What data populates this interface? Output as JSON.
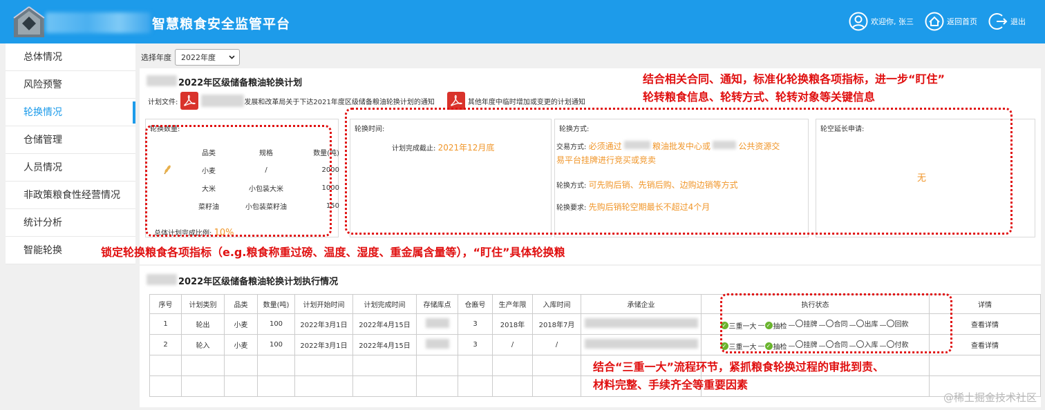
{
  "header": {
    "title": "智慧粮食安全监管平台",
    "welcome": "欢迎你, 张三",
    "home": "返回首页",
    "logout": "退出"
  },
  "sidebar": {
    "items": [
      "总体情况",
      "风险预警",
      "轮换情况",
      "仓储管理",
      "人员情况",
      "非政策粮食性经营情况",
      "统计分析",
      "智能轮换"
    ],
    "active_index": 2
  },
  "filter": {
    "label": "选择年度",
    "value": "2022年度"
  },
  "plan": {
    "title": "2022年区级储备粮油轮换计划",
    "files_label": "计划文件:",
    "file1": "发展和改革局关于下达2021年度区级储备粮油轮换计划的通知",
    "file2": "其他年度中临时增加或变更的计划通知",
    "qty_label": "轮换数量:",
    "qty_headers": [
      "品类",
      "规格",
      "数量(吨)"
    ],
    "qty_rows": [
      {
        "name": "小麦",
        "spec": "/",
        "qty": "2000"
      },
      {
        "name": "大米",
        "spec": "小包装大米",
        "qty": "1000"
      },
      {
        "name": "菜籽油",
        "spec": "小包装菜籽油",
        "qty": "150"
      }
    ],
    "completion_label": "总体计划完成比例:",
    "completion_value": "10%",
    "time_label": "轮换时间:",
    "deadline_label": "计划完成截止:",
    "deadline_value": "2021年12月底",
    "method_label": "轮换方式:",
    "trade_label": "交易方式:",
    "trade_value_a": "必须通过",
    "trade_value_b": "粮油批发中心或",
    "trade_value_c": "公共资源交",
    "trade_value_d": "易平台挂牌进行竞买或竞卖",
    "rot_label": "轮换方式:",
    "rot_value": "可先购后销、先销后购、边购边销等方式",
    "req_label": "轮换要求:",
    "req_value": "先购后销轮空期最长不超过4个月",
    "ext_label": "轮空延长申请:",
    "ext_value": "无"
  },
  "exec": {
    "title": "2022年区级储备粮油轮换计划执行情况",
    "headers": [
      "序号",
      "计划类别",
      "品类",
      "数量(吨)",
      "计划开始时间",
      "计划完成时间",
      "存储库点",
      "仓廒号",
      "生产年限",
      "入库时间",
      "承储企业",
      "执行状态",
      "详情"
    ],
    "rows": [
      {
        "no": "1",
        "type": "轮出",
        "cat": "小麦",
        "qty": "100",
        "start": "2022年3月1日",
        "end": "2022年4月15日",
        "bin": "3",
        "year": "2018年",
        "in": "2018年7月",
        "steps": [
          "三重一大",
          "抽检",
          "挂牌",
          "合同",
          "出库",
          "回款"
        ],
        "done": 2,
        "detail": "查看详情"
      },
      {
        "no": "2",
        "type": "轮入",
        "cat": "小麦",
        "qty": "100",
        "start": "2022年3月1日",
        "end": "2022年4月15日",
        "bin": "3",
        "year": "/",
        "in": "/",
        "steps": [
          "三重一大",
          "抽检",
          "挂牌",
          "合同",
          "入库",
          "付款"
        ],
        "done": 2,
        "detail": "查看详情"
      }
    ]
  },
  "annotations": {
    "top_line1": "结合相关合同、通知，标准化轮换粮各项指标，进一步“盯住”",
    "top_line2": "轮转粮食信息、轮转方式、轮转对象等关键信息",
    "middle": "锁定轮换粮食各项指标（e.g.粮食称重过磅、温度、湿度、重金属含量等），“盯住”具体轮换粮",
    "bottom_line1": "结合“三重一大”流程环节，紧抓粮食轮换过程的审批到责、",
    "bottom_line2": "材料完整、手续齐全等重要因素"
  },
  "watermark": "@稀土掘金技术社区",
  "colors": {
    "header": "#1d9bea",
    "accent_orange": "#f0962a",
    "annotation_red": "#e01010",
    "check_green": "#6ab42e"
  }
}
